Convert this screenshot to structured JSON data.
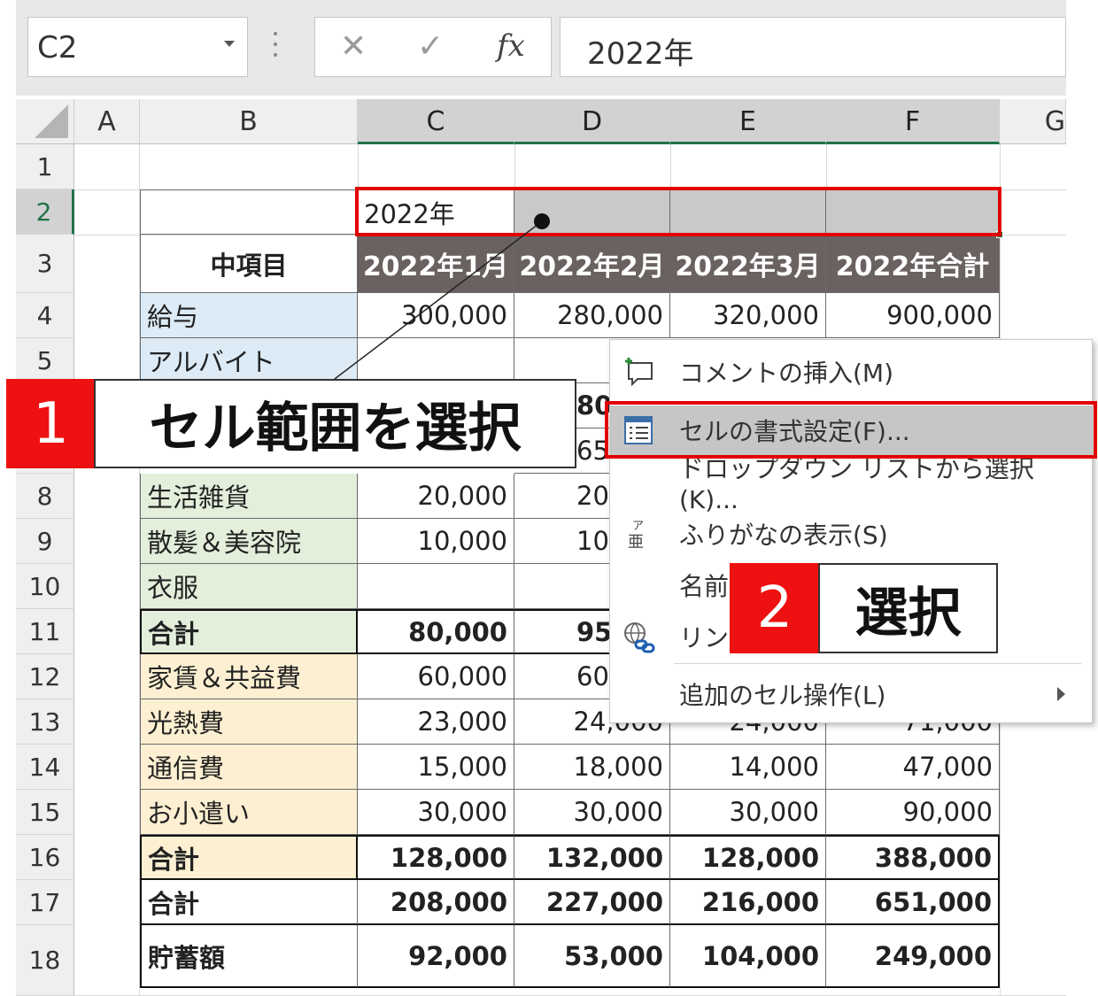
{
  "formula_bar": {
    "name_box": "C2",
    "cancel_symbol": "✕",
    "enter_symbol": "✓",
    "fx_label": "fx",
    "value": "2022年"
  },
  "columns": [
    "A",
    "B",
    "C",
    "D",
    "E",
    "F",
    "G"
  ],
  "rows": [
    "1",
    "2",
    "3",
    "4",
    "5",
    "6",
    "7",
    "8",
    "9",
    "10",
    "11",
    "12",
    "13",
    "14",
    "15",
    "16",
    "17",
    "18"
  ],
  "table": {
    "c2": "2022年",
    "b3": "中項目",
    "headers": [
      "2022年1月",
      "2022年2月",
      "2022年3月",
      "2022年合計"
    ],
    "r4": [
      "給与",
      "300,000",
      "280,000",
      "320,000",
      "900,000"
    ],
    "r5": [
      "アルバイト"
    ],
    "r6_partial": "80",
    "r7_partial": "65",
    "r8": [
      "生活雑貨",
      "20,000",
      "20"
    ],
    "r9": [
      "散髪＆美容院",
      "10,000",
      "10"
    ],
    "r10": [
      "衣服"
    ],
    "r11": [
      "合計",
      "80,000",
      "95"
    ],
    "r12": [
      "家賃＆共益費",
      "60,000",
      "60"
    ],
    "r13": [
      "光熱費",
      "23,000",
      "24,000",
      "24,000",
      "71,000"
    ],
    "r14": [
      "通信費",
      "15,000",
      "18,000",
      "14,000",
      "47,000"
    ],
    "r15": [
      "お小遣い",
      "30,000",
      "30,000",
      "30,000",
      "90,000"
    ],
    "r16": [
      "合計",
      "128,000",
      "132,000",
      "128,000",
      "388,000"
    ],
    "r17": [
      "合計",
      "208,000",
      "227,000",
      "216,000",
      "651,000"
    ],
    "r18": [
      "貯蓄額",
      "92,000",
      "53,000",
      "104,000",
      "249,000"
    ]
  },
  "context_menu": {
    "items": [
      {
        "label": "コメントの挿入(M)",
        "icon": "comment-insert-icon"
      },
      {
        "label": "セルの書式設定(F)...",
        "icon": "format-cells-icon"
      },
      {
        "label": "ドロップダウン リストから選択(K)...",
        "icon": ""
      },
      {
        "label": "ふりがなの表示(S)",
        "icon": "furigana-icon"
      },
      {
        "label": "名前",
        "icon": ""
      },
      {
        "label": "リンク",
        "icon": "link-icon"
      },
      {
        "label": "追加のセル操作(L)",
        "icon": "submenu-arrow-icon"
      }
    ],
    "highlight_color": "#c6c6c6"
  },
  "annotations": {
    "step1_number": "1",
    "step1_text": "セル範囲を選択",
    "step2_number": "2",
    "step2_text": "選択",
    "accent_color": "#e10000"
  }
}
